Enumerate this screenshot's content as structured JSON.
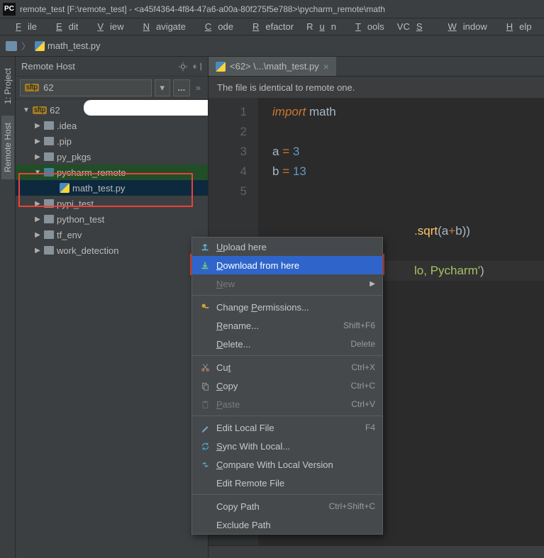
{
  "title": "remote_test [F:\\remote_test] - <a45f4364-4f84-47a6-a00a-80f275f5e788>\\pycharm_remote\\math",
  "pc_logo": "PC",
  "menubar": [
    "File",
    "Edit",
    "View",
    "Navigate",
    "Code",
    "Refactor",
    "Run",
    "Tools",
    "VCS",
    "Window",
    "Help"
  ],
  "breadcrumb": {
    "file": "math_test.py"
  },
  "gutter_tabs": {
    "project": "Project",
    "remote": "Remote Host"
  },
  "panel": {
    "title": "Remote Host",
    "host_select": "62",
    "dots": "...",
    "chevrons": "»"
  },
  "tree": {
    "root": "62",
    "items": [
      {
        "name": ".idea"
      },
      {
        "name": ".pip"
      },
      {
        "name": "py_pkgs"
      },
      {
        "name": "pycharm_remote",
        "open": true,
        "children": [
          {
            "name": "math_test.py",
            "isfile": true
          }
        ]
      },
      {
        "name": "pypi_test"
      },
      {
        "name": "python_test"
      },
      {
        "name": "tf_env"
      },
      {
        "name": "work_detection"
      }
    ]
  },
  "editor_tab": {
    "label": "<62> \\...\\math_test.py"
  },
  "notice": "The file is identical to remote one.",
  "gutter_lines": [
    "1",
    "2",
    "3",
    "4",
    "5"
  ],
  "code": {
    "import_kw": "import",
    "import_mod": "math",
    "var_a": "a",
    "eq": "=",
    "lit3": "3",
    "var_b": "b",
    "lit13": "13",
    "sqrt_tail_dot": ".",
    "sqrt_fn": "sqrt",
    "sqrt_open": "(",
    "sqrt_a": "a",
    "sqrt_plus": "+",
    "sqrt_b": "b",
    "sqrt_close": "))",
    "tail2_prefix": "lo, Pycharm'",
    "tail2_close": ")"
  },
  "context_menu": [
    {
      "label": "Upload here",
      "u": "U",
      "icon": "upload"
    },
    {
      "label": "Download from here",
      "u": "D",
      "icon": "download",
      "selected": true
    },
    {
      "label": "New",
      "u": "N",
      "submenu": true,
      "disabled": true
    },
    {
      "sep": true
    },
    {
      "label": "Change Permissions...",
      "u": "P",
      "icon": "perm"
    },
    {
      "label": "Rename...",
      "u": "R",
      "shortcut": "Shift+F6"
    },
    {
      "label": "Delete...",
      "u": "D",
      "shortcut": "Delete"
    },
    {
      "sep": true
    },
    {
      "label": "Cut",
      "u": "t",
      "icon": "cut",
      "shortcut": "Ctrl+X"
    },
    {
      "label": "Copy",
      "u": "C",
      "icon": "copy",
      "shortcut": "Ctrl+C"
    },
    {
      "label": "Paste",
      "u": "P",
      "icon": "paste",
      "shortcut": "Ctrl+V",
      "disabled": true
    },
    {
      "sep": true
    },
    {
      "label": "Edit Local File",
      "icon": "edit",
      "shortcut": "F4"
    },
    {
      "label": "Sync With Local...",
      "u": "S",
      "icon": "sync"
    },
    {
      "label": "Compare With Local Version",
      "u": "C",
      "icon": "compare"
    },
    {
      "label": "Edit Remote File"
    },
    {
      "sep": true
    },
    {
      "label": "Copy Path",
      "shortcut": "Ctrl+Shift+C"
    },
    {
      "label": "Exclude Path"
    }
  ]
}
